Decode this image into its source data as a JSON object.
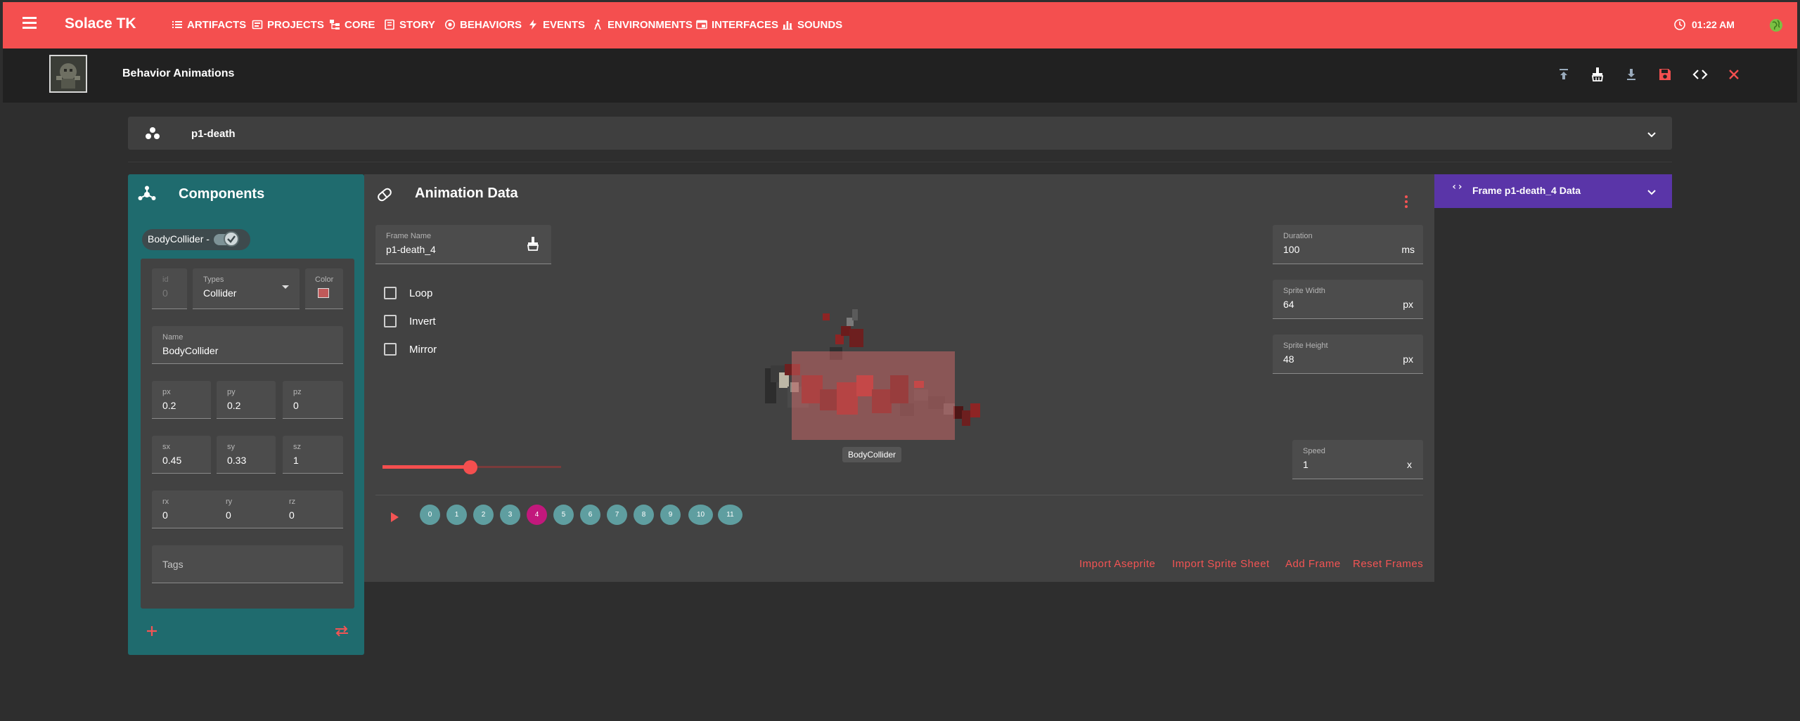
{
  "app": {
    "title": "Solace TK"
  },
  "nav": [
    {
      "label": "ARTIFACTS",
      "icon": "list-icon"
    },
    {
      "label": "PROJECTS",
      "icon": "projects-icon"
    },
    {
      "label": "CORE",
      "icon": "tree-icon"
    },
    {
      "label": "STORY",
      "icon": "book-icon"
    },
    {
      "label": "BEHAVIORS",
      "icon": "target-icon"
    },
    {
      "label": "EVENTS",
      "icon": "bolt-icon"
    },
    {
      "label": "ENVIRONMENTS",
      "icon": "figure-icon"
    },
    {
      "label": "INTERFACES",
      "icon": "window-icon"
    },
    {
      "label": "SOUNDS",
      "icon": "bars-icon"
    }
  ],
  "clock": {
    "time": "01:22 AM"
  },
  "header": {
    "title": "Behavior Animations",
    "actions": [
      "upload-icon",
      "clean-icon",
      "download-icon",
      "save-icon",
      "code-icon",
      "close-icon"
    ]
  },
  "behavior": {
    "name": "p1-death"
  },
  "components": {
    "title": "Components",
    "chip_label": "BodyCollider -",
    "fields": {
      "id": {
        "label": "id",
        "value": "0"
      },
      "types": {
        "label": "Types",
        "value": "Collider"
      },
      "color": {
        "label": "Color",
        "value": "#c05a5a"
      },
      "name": {
        "label": "Name",
        "value": "BodyCollider"
      },
      "px": {
        "label": "px",
        "value": "0.2"
      },
      "py": {
        "label": "py",
        "value": "0.2"
      },
      "pz": {
        "label": "pz",
        "value": "0"
      },
      "sx": {
        "label": "sx",
        "value": "0.45"
      },
      "sy": {
        "label": "sy",
        "value": "0.33"
      },
      "sz": {
        "label": "sz",
        "value": "1"
      },
      "rx": {
        "label": "rx",
        "value": "0"
      },
      "ry": {
        "label": "ry",
        "value": "0"
      },
      "rz": {
        "label": "rz",
        "value": "0"
      },
      "tags": {
        "label": "Tags",
        "value": ""
      }
    }
  },
  "animation": {
    "title": "Animation Data",
    "frame_name": {
      "label": "Frame Name",
      "value": "p1-death_4"
    },
    "duration": {
      "label": "Duration",
      "value": "100",
      "unit": "ms"
    },
    "sprite_width": {
      "label": "Sprite Width",
      "value": "64",
      "unit": "px"
    },
    "sprite_height": {
      "label": "Sprite Height",
      "value": "48",
      "unit": "px"
    },
    "speed": {
      "label": "Speed",
      "value": "1",
      "unit": "x"
    },
    "checkboxes": [
      {
        "label": "Loop",
        "checked": false
      },
      {
        "label": "Invert",
        "checked": false
      },
      {
        "label": "Mirror",
        "checked": false
      }
    ],
    "collider_label": "BodyCollider",
    "slider_value": 0.4,
    "frames": [
      "0",
      "1",
      "2",
      "3",
      "4",
      "5",
      "6",
      "7",
      "8",
      "9",
      "10",
      "11"
    ],
    "active_frame": 4,
    "actions": [
      "Import Aseprite",
      "Import Sprite Sheet",
      "Add Frame",
      "Reset Frames"
    ]
  },
  "frame_data": {
    "icon": "‹›",
    "title": "Frame p1-death_4 Data"
  },
  "colors": {
    "topbar": "#f44f4f",
    "teal_panel": "#1f6b6e",
    "purple_bar": "#5a35a8",
    "active_frame": "#c2187c",
    "frame": "#5f9ea0"
  }
}
